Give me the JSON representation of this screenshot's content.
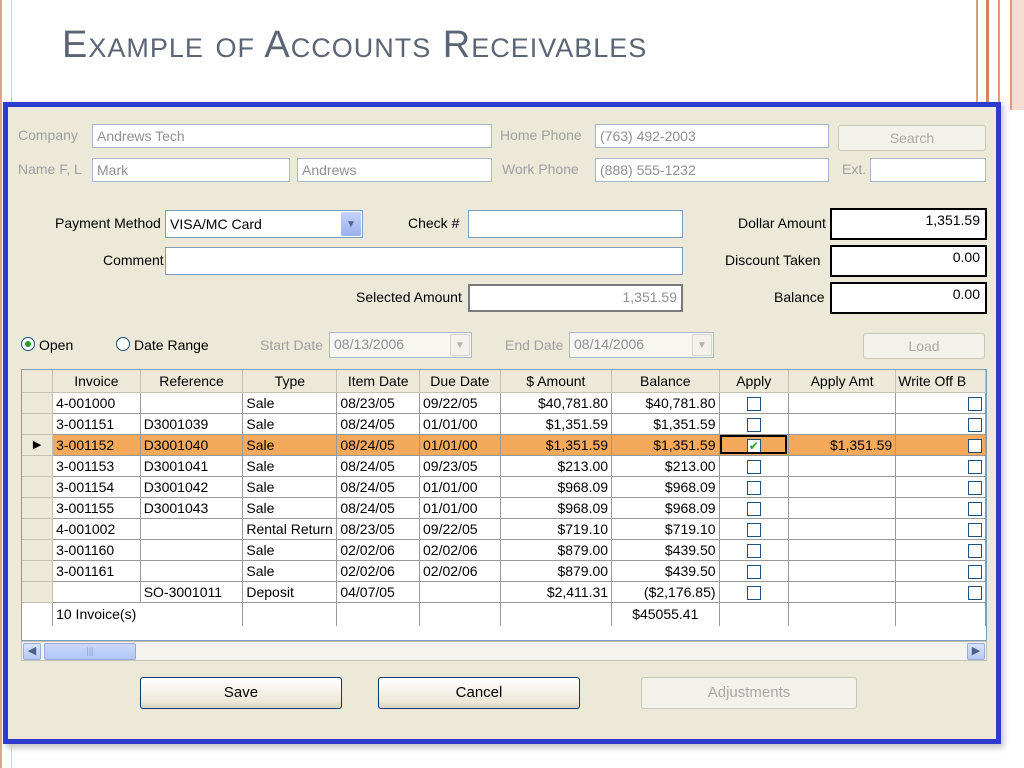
{
  "slide": {
    "title": "Example of Accounts Receivables"
  },
  "customer": {
    "company_label": "Company",
    "company": "Andrews Tech",
    "name_label": "Name F, L",
    "first_name": "Mark",
    "last_name": "Andrews",
    "home_phone_label": "Home Phone",
    "home_phone": "(763) 492-2003",
    "work_phone_label": "Work Phone",
    "work_phone": "(888) 555-1232",
    "ext_label": "Ext.",
    "ext": "",
    "search_label": "Search"
  },
  "payment": {
    "method_label": "Payment Method",
    "method_value": "VISA/MC  Card",
    "check_label": "Check #",
    "check_value": "",
    "comment_label": "Comment",
    "comment_value": "",
    "selected_amount_label": "Selected Amount",
    "selected_amount": "1,351.59",
    "dollar_amount_label": "Dollar Amount",
    "dollar_amount": "1,351.59",
    "discount_label": "Discount Taken",
    "discount": "0.00",
    "balance_label": "Balance",
    "balance": "0.00"
  },
  "filter": {
    "open_label": "Open",
    "open_selected": true,
    "date_range_label": "Date Range",
    "start_label": "Start Date",
    "start_date": "08/13/2006",
    "end_label": "End Date",
    "end_date": "08/14/2006",
    "load_label": "Load"
  },
  "grid": {
    "columns": [
      "Invoice",
      "Reference",
      "Type",
      "Item Date",
      "Due Date",
      "$ Amount",
      "Balance",
      "Apply",
      "Apply Amt",
      "Write Off B"
    ],
    "rows": [
      {
        "invoice": "4-001000",
        "reference": "",
        "type": "Sale",
        "item_date": "08/23/05",
        "due_date": "09/22/05",
        "amount": "$40,781.80",
        "balance": "$40,781.80",
        "apply": false,
        "apply_amt": "",
        "selected": false
      },
      {
        "invoice": "3-001151",
        "reference": "D3001039",
        "type": "Sale",
        "item_date": "08/24/05",
        "due_date": "01/01/00",
        "amount": "$1,351.59",
        "balance": "$1,351.59",
        "apply": false,
        "apply_amt": "",
        "selected": false
      },
      {
        "invoice": "3-001152",
        "reference": "D3001040",
        "type": "Sale",
        "item_date": "08/24/05",
        "due_date": "01/01/00",
        "amount": "$1,351.59",
        "balance": "$1,351.59",
        "apply": true,
        "apply_amt": "$1,351.59",
        "selected": true
      },
      {
        "invoice": "3-001153",
        "reference": "D3001041",
        "type": "Sale",
        "item_date": "08/24/05",
        "due_date": "09/23/05",
        "amount": "$213.00",
        "balance": "$213.00",
        "apply": false,
        "apply_amt": "",
        "selected": false
      },
      {
        "invoice": "3-001154",
        "reference": "D3001042",
        "type": "Sale",
        "item_date": "08/24/05",
        "due_date": "01/01/00",
        "amount": "$968.09",
        "balance": "$968.09",
        "apply": false,
        "apply_amt": "",
        "selected": false
      },
      {
        "invoice": "3-001155",
        "reference": "D3001043",
        "type": "Sale",
        "item_date": "08/24/05",
        "due_date": "01/01/00",
        "amount": "$968.09",
        "balance": "$968.09",
        "apply": false,
        "apply_amt": "",
        "selected": false
      },
      {
        "invoice": "4-001002",
        "reference": "",
        "type": "Rental Return",
        "item_date": "08/23/05",
        "due_date": "09/22/05",
        "amount": "$719.10",
        "balance": "$719.10",
        "apply": false,
        "apply_amt": "",
        "selected": false
      },
      {
        "invoice": "3-001160",
        "reference": "",
        "type": "Sale",
        "item_date": "02/02/06",
        "due_date": "02/02/06",
        "amount": "$879.00",
        "balance": "$439.50",
        "apply": false,
        "apply_amt": "",
        "selected": false
      },
      {
        "invoice": "3-001161",
        "reference": "",
        "type": "Sale",
        "item_date": "02/02/06",
        "due_date": "02/02/06",
        "amount": "$879.00",
        "balance": "$439.50",
        "apply": false,
        "apply_amt": "",
        "selected": false
      },
      {
        "invoice": "",
        "reference": "SO-3001011",
        "type": "Deposit",
        "item_date": "04/07/05",
        "due_date": "",
        "amount": "$2,411.31",
        "balance": "($2,176.85)",
        "apply": false,
        "apply_amt": "",
        "selected": false
      }
    ],
    "footer": {
      "count": "10 Invoice(s)",
      "balance_total": "$45055.41"
    }
  },
  "buttons": {
    "save": "Save",
    "cancel": "Cancel",
    "adjustments": "Adjustments"
  },
  "colors": {
    "window_border": "#2d3ccf",
    "window_bg": "#ece9d8",
    "selected_row": "#f5a95a",
    "title": "#5b6576"
  }
}
